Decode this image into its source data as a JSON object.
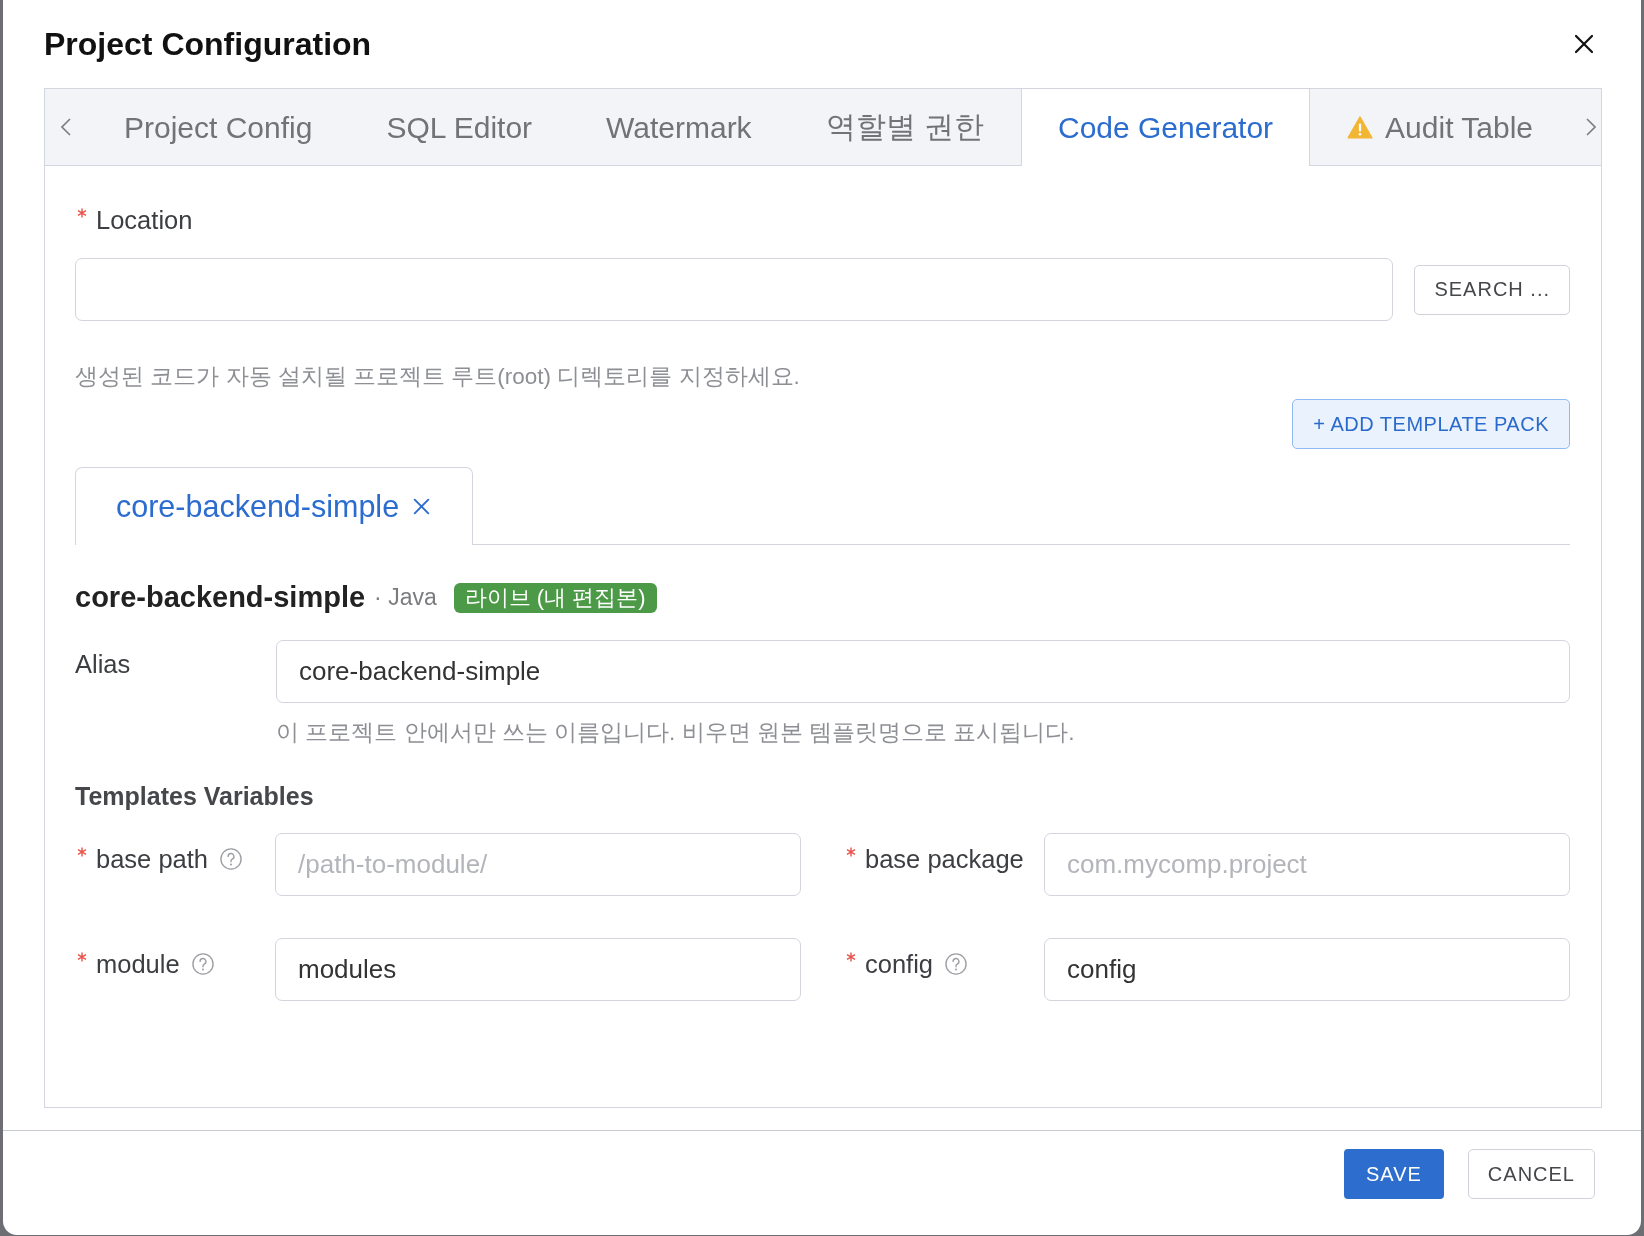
{
  "dialog": {
    "title": "Project Configuration"
  },
  "tabs": [
    {
      "label": "Project Config",
      "selected": false,
      "warning": false
    },
    {
      "label": "SQL Editor",
      "selected": false,
      "warning": false
    },
    {
      "label": "Watermark",
      "selected": false,
      "warning": false
    },
    {
      "label": "역할별 권한",
      "selected": false,
      "warning": false
    },
    {
      "label": "Code Generator",
      "selected": true,
      "warning": false
    },
    {
      "label": "Audit Table",
      "selected": false,
      "warning": true
    }
  ],
  "location": {
    "label": "Location",
    "required": true,
    "button": "SEARCH ...",
    "hint": "생성된 코드가 자동 설치될 프로젝트 루트(root) 디렉토리를 지정하세요."
  },
  "add_template_button": "+ ADD TEMPLATE PACK",
  "template_tabs": [
    {
      "label": "core-backend-simple",
      "selected": true
    }
  ],
  "template": {
    "name": "core-backend-simple",
    "language": "· Java",
    "badge": "라이브 (내 편집본)"
  },
  "alias": {
    "label": "Alias",
    "value": "core-backend-simple",
    "hint": "이 프로젝트 안에서만 쓰는 이름입니다. 비우면 원본 템플릿명으로 표시됩니다."
  },
  "variables": {
    "title": "Templates Variables",
    "fields": [
      {
        "label": "base path",
        "required": true,
        "help": true,
        "placeholder": "/path-to-module/"
      },
      {
        "label": "base package",
        "required": true,
        "help": false,
        "placeholder": "com.mycomp.project"
      },
      {
        "label": "module",
        "required": true,
        "help": true,
        "value": "modules"
      },
      {
        "label": "config",
        "required": true,
        "help": true,
        "value": "config"
      }
    ]
  },
  "footer": {
    "buttons": [
      {
        "label": "SAVE",
        "kind": "primary"
      },
      {
        "label": "CANCEL",
        "kind": "secondary"
      }
    ]
  }
}
